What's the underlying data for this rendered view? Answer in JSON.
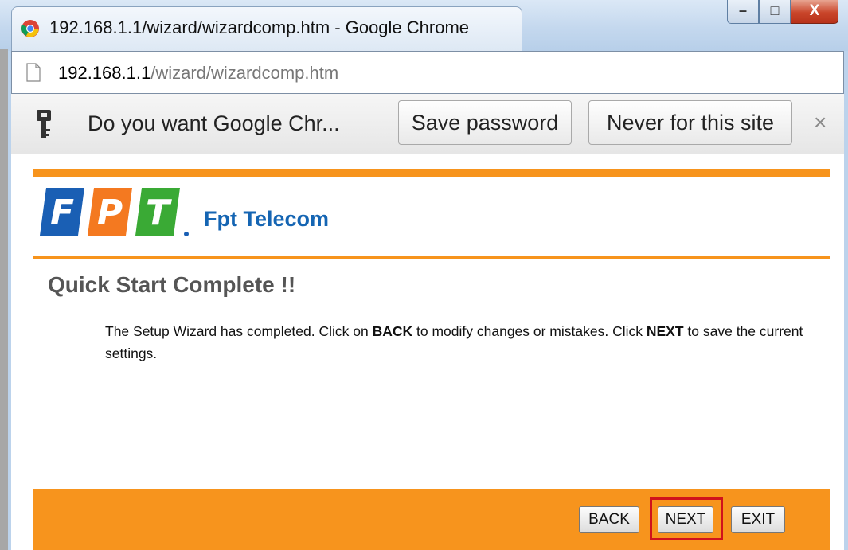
{
  "window": {
    "title": "192.168.1.1/wizard/wizardcomp.htm - Google Chrome",
    "minimize_glyph": "–",
    "maximize_glyph": "□",
    "close_glyph": "X"
  },
  "address_bar": {
    "host": "192.168.1.1",
    "path": "/wizard/wizardcomp.htm"
  },
  "infobar": {
    "message": "Do you want Google Chr...",
    "save_label": "Save password",
    "never_label": "Never for this site",
    "close_glyph": "×"
  },
  "page": {
    "brand_name": "Fpt Telecom",
    "logo_letters": [
      "F",
      "P",
      "T"
    ],
    "heading": "Quick Start Complete !!",
    "description": {
      "part1": "The Setup Wizard has completed. Click on ",
      "back_word": "BACK",
      "part2": " to modify changes or mistakes. Click ",
      "next_word": "NEXT",
      "part3": " to save the current settings."
    },
    "buttons": {
      "back": "BACK",
      "next": "NEXT",
      "exit": "EXIT"
    }
  },
  "colors": {
    "accent_orange": "#f7941d",
    "brand_blue": "#1565b3",
    "highlight_red": "#d0121b"
  },
  "icons": {
    "browser": "chrome-icon",
    "page": "page-icon",
    "infobar": "key-icon"
  }
}
